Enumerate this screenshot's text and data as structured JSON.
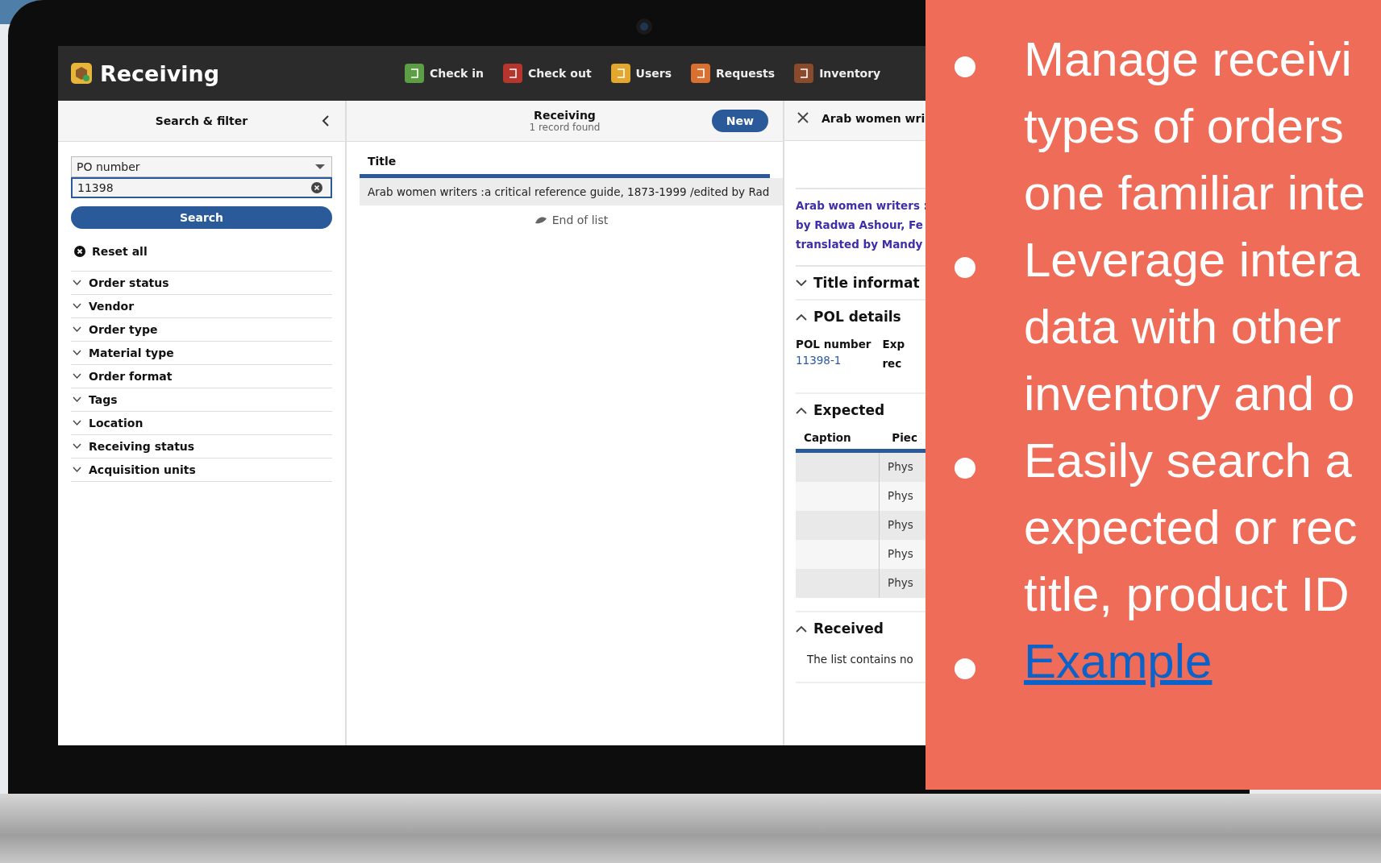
{
  "app": {
    "title": "Receiving",
    "nav": [
      {
        "label": "Check in",
        "color": "#5c9e43"
      },
      {
        "label": "Check out",
        "color": "#b8352e"
      },
      {
        "label": "Users",
        "color": "#e2a72c"
      },
      {
        "label": "Requests",
        "color": "#d9702f"
      },
      {
        "label": "Inventory",
        "color": "#8a4b2c"
      }
    ]
  },
  "filter_pane": {
    "title": "Search & filter",
    "search_option": "PO number",
    "search_value": "11398",
    "search_button": "Search",
    "reset": "Reset all",
    "filters": [
      {
        "label": "Order status",
        "expanded": false
      },
      {
        "label": "Vendor",
        "expanded": false
      },
      {
        "label": "Order type",
        "expanded": false
      },
      {
        "label": "Material type",
        "expanded": false
      },
      {
        "label": "Order format",
        "expanded": false
      },
      {
        "label": "Tags",
        "expanded": false
      },
      {
        "label": "Location",
        "expanded": false
      },
      {
        "label": "Receiving status",
        "expanded": false
      },
      {
        "label": "Acquisition units",
        "expanded": false
      }
    ]
  },
  "results_pane": {
    "title": "Receiving",
    "subtitle": "1 record found",
    "new_button": "New",
    "column": "Title",
    "rows": [
      "Arab women writers :a critical reference guide, 1873-1999 /edited by Rad"
    ],
    "end_of_list": "End of list"
  },
  "detail_pane": {
    "title": "Arab women wri",
    "title_lines": [
      "Arab women writers :",
      "by Radwa Ashour, Fe",
      "translated by Mandy"
    ],
    "sections": [
      {
        "title": "Title informat",
        "expanded": false
      },
      {
        "kind": "fields",
        "title": "POL details",
        "expanded": true,
        "fields": [
          {
            "label_lines": [
              "POL number"
            ],
            "value": "11398-1"
          },
          {
            "label_lines": [
              "Exp",
              "rec"
            ]
          }
        ]
      },
      {
        "kind": "table",
        "title": "Expected",
        "expanded": true,
        "columns": [
          "Caption",
          "Piec"
        ],
        "rows": [
          "Phys",
          "Phys",
          "Phys",
          "Phys",
          "Phys"
        ]
      },
      {
        "kind": "empty",
        "title": "Received",
        "expanded": true,
        "message": "The list contains no"
      }
    ]
  },
  "slide": {
    "bullets": [
      {
        "kind": "text",
        "lines": [
          "Manage receivi",
          "types of orders",
          "one familiar inte"
        ]
      },
      {
        "kind": "text",
        "lines": [
          "Leverage intera",
          "data with other",
          "inventory and o"
        ]
      },
      {
        "kind": "text",
        "lines": [
          "Easily search a",
          "expected or rec",
          "title, product ID"
        ]
      },
      {
        "kind": "link",
        "lines": [
          "Example"
        ]
      }
    ]
  }
}
